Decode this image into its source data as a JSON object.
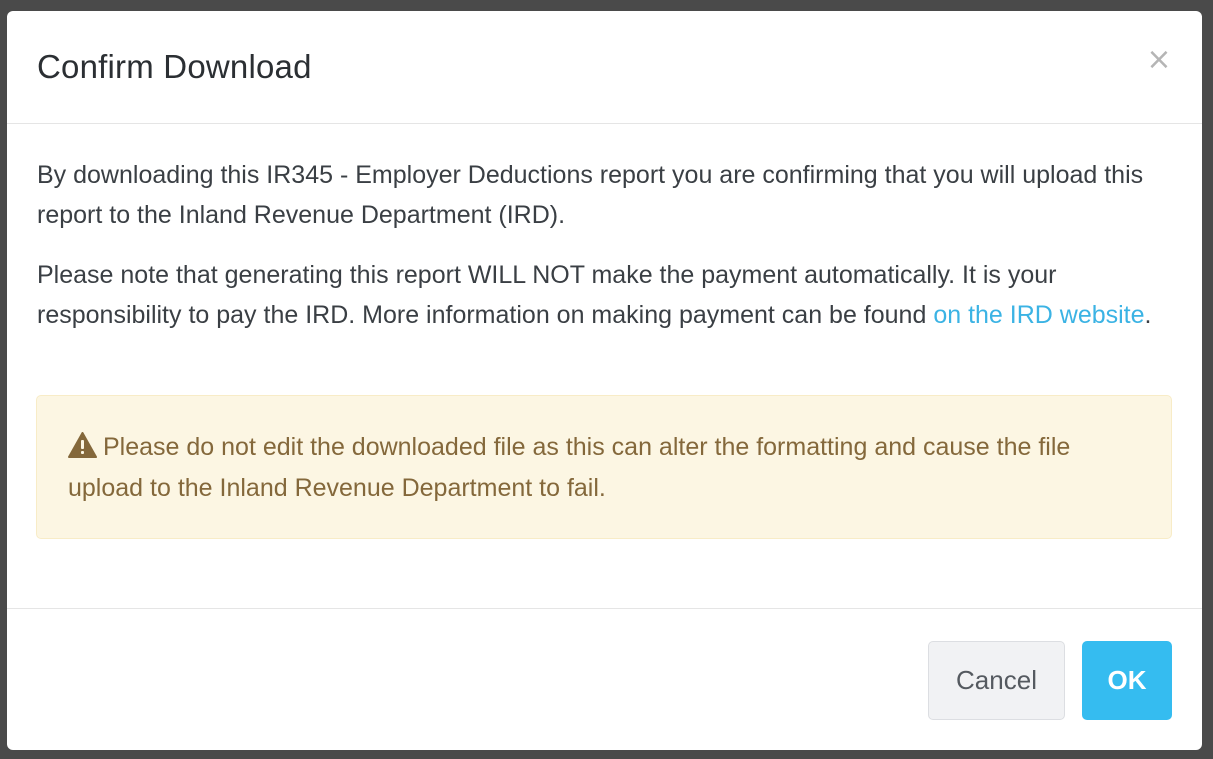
{
  "dialog": {
    "title": "Confirm Download",
    "close_label": "×",
    "paragraph1": "By downloading this IR345 - Employer Deductions report you are confirming that you will upload this report to the Inland Revenue Department (IRD).",
    "paragraph2_text": "Please note that generating this report WILL NOT make the payment automatically. It is your responsibility to pay the IRD. More information on making payment can be found ",
    "paragraph2_link": "on the IRD website",
    "paragraph2_end": ".",
    "warning": {
      "icon": "warning-triangle-icon",
      "text": "Please do not edit the downloaded file as this can alter the formatting and cause the file upload to the Inland Revenue Department to fail."
    },
    "buttons": {
      "cancel": "Cancel",
      "ok": "OK"
    }
  },
  "colors": {
    "link": "#3bb3e4",
    "primary_button": "#35bcf0",
    "warning_background": "#fcf6e3",
    "warning_text": "#84683b"
  }
}
